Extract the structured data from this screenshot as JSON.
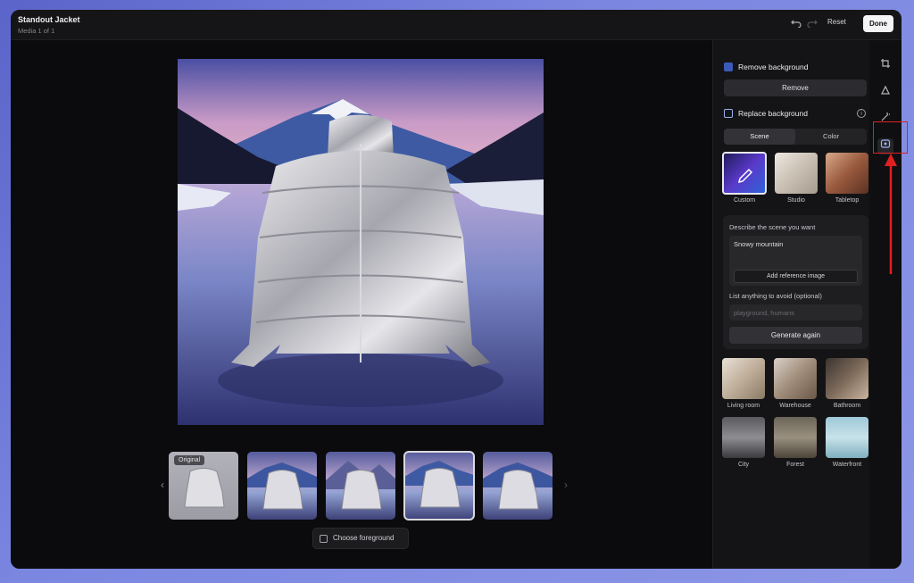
{
  "header": {
    "title": "Standout Jacket",
    "subtitle": "Media 1 of 1",
    "undo_icon": "undo-icon",
    "redo_icon": "redo-icon",
    "reset_label": "Reset",
    "done_label": "Done"
  },
  "thumbnails": [
    {
      "label": "Original",
      "selected": false
    },
    {
      "label": "",
      "selected": false
    },
    {
      "label": "",
      "selected": false
    },
    {
      "label": "",
      "selected": true
    },
    {
      "label": "",
      "selected": false
    }
  ],
  "choose_foreground_label": "Choose foreground",
  "panel": {
    "remove_bg": {
      "title": "Remove background",
      "button": "Remove"
    },
    "replace_bg": {
      "title": "Replace background",
      "tabs": [
        "Scene",
        "Color"
      ],
      "active_tab": "Scene",
      "top_scenes": [
        "Custom",
        "Studio",
        "Tabletop"
      ],
      "prompt": {
        "describe_label": "Describe the scene you want",
        "describe_value": "Snowy mountain",
        "add_reference_label": "Add reference image",
        "avoid_label": "List anything to avoid (optional)",
        "avoid_placeholder": "playground, humans",
        "generate_label": "Generate again"
      },
      "scenes": [
        "Living room",
        "Warehouse",
        "Bathroom",
        "City",
        "Forest",
        "Waterfront"
      ]
    }
  },
  "rail_icons": [
    "crop-icon",
    "adjust-icon",
    "magic-wand-icon",
    "replace-background-icon"
  ],
  "colors": {
    "accent_red": "#e02020",
    "background": "#0b0b0d"
  }
}
